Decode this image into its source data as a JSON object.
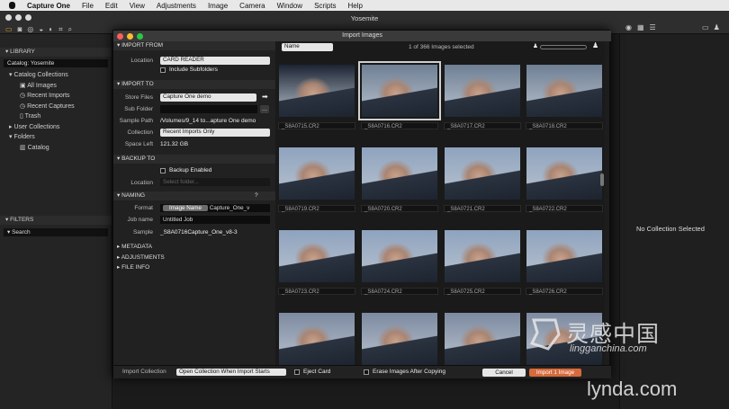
{
  "menubar": {
    "apple": "",
    "app": "Capture One",
    "items": [
      "File",
      "Edit",
      "View",
      "Adjustments",
      "Image",
      "Camera",
      "Window",
      "Scripts",
      "Help"
    ]
  },
  "window": {
    "title": "Yosemite"
  },
  "library": {
    "header": "LIBRARY",
    "catalog": "Catalog: Yosemite",
    "catalog_collections": "Catalog Collections",
    "items": [
      "All Images",
      "Recent Imports",
      "Recent Captures",
      "Trash"
    ],
    "user_collections": "User Collections",
    "folders": "Folders",
    "catalog_item": "Catalog",
    "filters": "FILTERS",
    "search_placeholder": "Search"
  },
  "right_panel": {
    "empty": "No Collection Selected"
  },
  "dialog": {
    "title": "Import Images",
    "import_from": {
      "header": "IMPORT FROM",
      "location_label": "Location",
      "location": "CARD READER",
      "include_subfolders": "Include Subfolders"
    },
    "import_to": {
      "header": "IMPORT TO",
      "store_label": "Store Files",
      "store": "Capture One demo",
      "sub_label": "Sub Folder",
      "sample_path_label": "Sample Path",
      "sample_path": "/Volumes/9_14 to...apture One demo",
      "collection_label": "Collection",
      "collection": "Recent Imports Only",
      "space_label": "Space Left",
      "space": "121.32 GB"
    },
    "backup": {
      "header": "BACKUP TO",
      "enabled": "Backup Enabled",
      "location_label": "Location",
      "location_placeholder": "Select folder..."
    },
    "naming": {
      "header": "NAMING",
      "help": "?",
      "format_label": "Format",
      "token": "Image Name",
      "format_text": "Capture_One_v",
      "jobname_label": "Job name",
      "jobname": "Untitled Job",
      "sample_label": "Sample",
      "sample": "_S8A0716Capture_One_v8-3"
    },
    "metadata": "METADATA",
    "adjustments": "ADJUSTMENTS",
    "fileinfo": "FILE INFO",
    "sort": "Name",
    "count": "1 of 366 Images selected",
    "files": [
      "_S8A0715.CR2",
      "_S8A0716.CR2",
      "_S8A0717.CR2",
      "_S8A0718.CR2",
      "_S8A0719.CR2",
      "_S8A0720.CR2",
      "_S8A0721.CR2",
      "_S8A0722.CR2",
      "_S8A0723.CR2",
      "_S8A0724.CR2",
      "_S8A0725.CR2",
      "_S8A0726.CR2"
    ],
    "bottom": {
      "collection_label": "Import Collection",
      "collection": "Open Collection When Import Starts",
      "eject": "Eject Card",
      "erase": "Erase Images After Copying",
      "cancel": "Cancel",
      "import": "Import 1 Image"
    }
  },
  "watermark": {
    "brand_cn": "灵感中国",
    "brand_url": "lingganchina.com",
    "lynda": "lynda.com"
  }
}
